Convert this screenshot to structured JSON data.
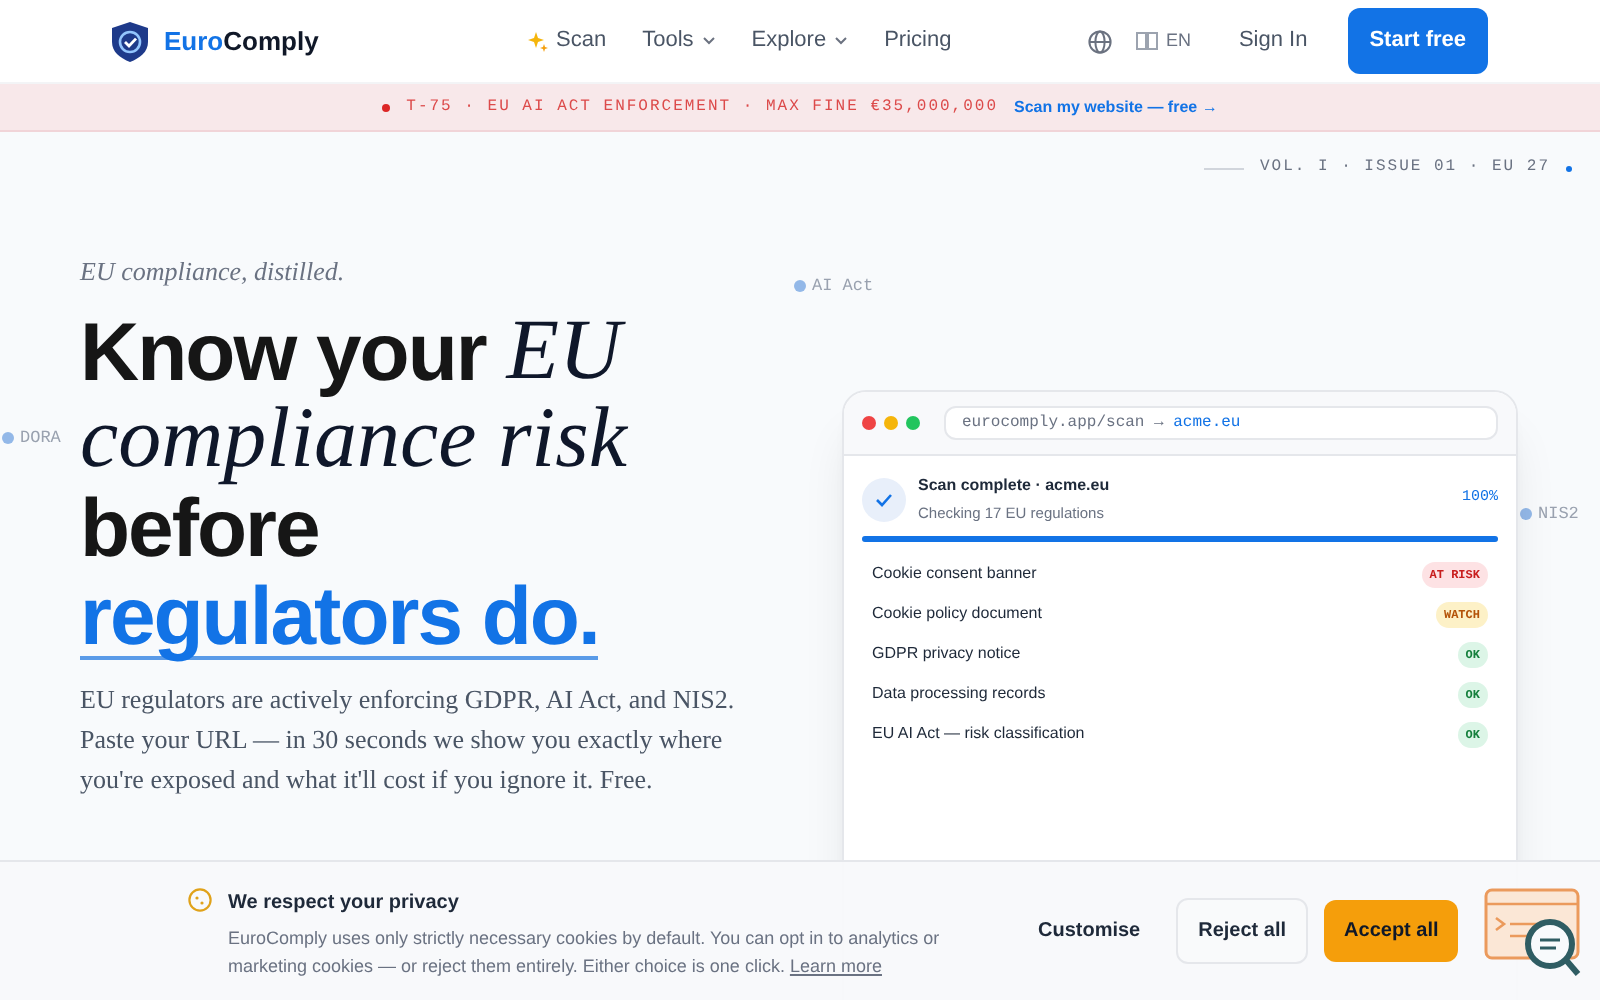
{
  "nav": {
    "brand": [
      {
        "text": "Euro",
        "kind": "accent"
      },
      {
        "text": "Comply",
        "kind": "dark"
      }
    ],
    "links": [
      {
        "label": "Scan",
        "kind": "sparkle"
      },
      {
        "label": "Tools",
        "kind": "menu"
      },
      {
        "label": "Explore",
        "kind": "menu"
      },
      {
        "label": "Pricing",
        "kind": "plain"
      }
    ],
    "language": "EN",
    "sign_in": "Sign In",
    "cta": "Start free"
  },
  "announcement": {
    "text": "T-75 · EU AI ACT ENFORCEMENT · MAX FINE €35,000,000",
    "link": "Scan my website — free →"
  },
  "edition": "VOL. I · ISSUE 01 · EU 27",
  "hero": {
    "eyebrow": "EU compliance, distilled.",
    "headline": [
      [
        {
          "text": "Know your ",
          "kind": "sans"
        },
        {
          "text": "EU",
          "kind": "serif"
        }
      ],
      [
        {
          "text": "compliance risk",
          "kind": "serif"
        }
      ],
      [
        {
          "text": "before",
          "kind": "sans"
        }
      ],
      [
        {
          "text": "regulators do.",
          "kind": "accent"
        }
      ]
    ],
    "body": "EU regulators are actively enforcing GDPR, AI Act, and NIS2. Paste your URL — in 30 seconds we show you exactly where you're exposed and what it'll cost if you ignore it. Free."
  },
  "tags": [
    "AI Act",
    "DORA",
    "NIS2"
  ],
  "scan_window": {
    "address": "eurocomply.app/scan → ",
    "domain": "acme.eu",
    "title": "Scan complete · acme.eu",
    "subtitle": "Checking 17 EU regulations",
    "percent": "100%",
    "level": 1,
    "checks": [
      {
        "label": "Cookie consent banner",
        "status": "AT RISK",
        "kind": "risk"
      },
      {
        "label": "Cookie policy document",
        "status": "WATCH",
        "kind": "watch"
      },
      {
        "label": "GDPR privacy notice",
        "status": "OK",
        "kind": "ok"
      },
      {
        "label": "Data processing records",
        "status": "OK",
        "kind": "ok"
      },
      {
        "label": "EU AI Act — risk classification",
        "status": "OK",
        "kind": "ok"
      }
    ]
  },
  "cookie_banner": {
    "title": "We respect your privacy",
    "text": "EuroComply uses only strictly necessary cookies by default. You can opt in to analytics or marketing cookies — or reject them entirely. Either choice is one click.",
    "link": "Learn more",
    "buttons": [
      {
        "label": "Customise",
        "kind": "text"
      },
      {
        "label": "Reject all",
        "kind": "outline"
      },
      {
        "label": "Accept all",
        "kind": "primary"
      }
    ]
  }
}
